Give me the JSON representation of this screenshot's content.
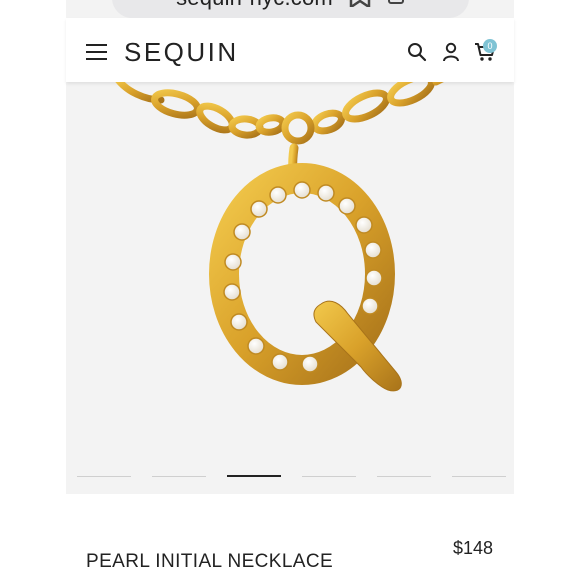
{
  "browser": {
    "url": "sequin-nyc.com"
  },
  "header": {
    "logo": "SEQUIN",
    "cart_count": "0"
  },
  "carousel": {
    "total": 6,
    "active": 3
  },
  "product": {
    "title": "PEARL INITIAL NECKLACE",
    "price": "$148",
    "initial": "Q"
  },
  "colors": {
    "gold": "#d9a12a",
    "pearl": "#f4efe6",
    "badge": "#7fc3d4"
  },
  "icons": [
    "hamburger-icon",
    "search-icon",
    "account-icon",
    "cart-icon",
    "bookmark-icon",
    "copy-icon"
  ]
}
